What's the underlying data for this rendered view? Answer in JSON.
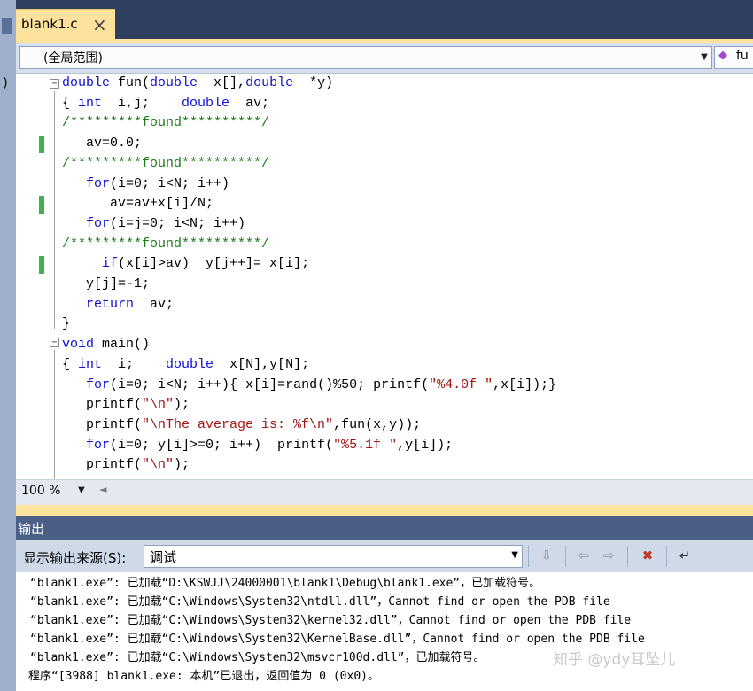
{
  "tab": {
    "filename": "blank1.c",
    "close_glyph": "×"
  },
  "scope_bar": {
    "scope": "(全局范围)",
    "member": "fu"
  },
  "editor": {
    "lines": [
      [
        {
          "t": "double",
          "c": "kw"
        },
        {
          "t": " fun("
        },
        {
          "t": "double",
          "c": "kw"
        },
        {
          "t": "  x[],"
        },
        {
          "t": "double",
          "c": "kw"
        },
        {
          "t": "  *y)"
        }
      ],
      [
        {
          "t": "{ "
        },
        {
          "t": "int",
          "c": "kw"
        },
        {
          "t": "  i,j;    "
        },
        {
          "t": "double",
          "c": "kw"
        },
        {
          "t": "  av;"
        }
      ],
      [
        {
          "t": "/*********found**********/",
          "c": "cm"
        }
      ],
      [
        {
          "t": "   av=0.0;"
        }
      ],
      [
        {
          "t": "/*********found**********/",
          "c": "cm"
        }
      ],
      [
        {
          "t": "   "
        },
        {
          "t": "for",
          "c": "kw"
        },
        {
          "t": "(i=0; i<N; i++)"
        }
      ],
      [
        {
          "t": "      av=av+x[i]/N;"
        }
      ],
      [
        {
          "t": "   "
        },
        {
          "t": "for",
          "c": "kw"
        },
        {
          "t": "(i=j=0; i<N; i++)"
        }
      ],
      [
        {
          "t": "/*********found**********/",
          "c": "cm"
        }
      ],
      [
        {
          "t": "     "
        },
        {
          "t": "if",
          "c": "kw"
        },
        {
          "t": "(x[i]>av)  y[j++]= x[i];"
        }
      ],
      [
        {
          "t": "   y[j]=-1;"
        }
      ],
      [
        {
          "t": "   "
        },
        {
          "t": "return",
          "c": "kw"
        },
        {
          "t": "  av;"
        }
      ],
      [
        {
          "t": "}"
        }
      ],
      [
        {
          "t": "void",
          "c": "kw"
        },
        {
          "t": " main()"
        }
      ],
      [
        {
          "t": "{ "
        },
        {
          "t": "int",
          "c": "kw"
        },
        {
          "t": "  i;    "
        },
        {
          "t": "double",
          "c": "kw"
        },
        {
          "t": "  x[N],y[N];"
        }
      ],
      [
        {
          "t": "   "
        },
        {
          "t": "for",
          "c": "kw"
        },
        {
          "t": "(i=0; i<N; i++){ x[i]=rand()%50; printf("
        },
        {
          "t": "\"%4.0f \"",
          "c": "st"
        },
        {
          "t": ",x[i]);}"
        }
      ],
      [
        {
          "t": "   printf("
        },
        {
          "t": "\"\\n\"",
          "c": "st"
        },
        {
          "t": ");"
        }
      ],
      [
        {
          "t": "   printf("
        },
        {
          "t": "\"\\nThe average is: %f\\n\"",
          "c": "st"
        },
        {
          "t": ",fun(x,y));"
        }
      ],
      [
        {
          "t": "   "
        },
        {
          "t": "for",
          "c": "kw"
        },
        {
          "t": "(i=0; y[i]>=0; i++)  printf("
        },
        {
          "t": "\"%5.1f \"",
          "c": "st"
        },
        {
          "t": ",y[i]);"
        }
      ],
      [
        {
          "t": "   printf("
        },
        {
          "t": "\"\\n\"",
          "c": "st"
        },
        {
          "t": ");"
        }
      ]
    ]
  },
  "status": {
    "zoom": "100 %"
  },
  "output": {
    "title": "输出",
    "source_label": "显示输出来源(S):",
    "source_value": "调试",
    "lines": [
      "“blank1.exe”: 已加载“D:\\KSWJJ\\24000001\\blank1\\Debug\\blank1.exe”，已加载符号。",
      "“blank1.exe”: 已加载“C:\\Windows\\System32\\ntdll.dll”，Cannot find or open the PDB file",
      "“blank1.exe”: 已加载“C:\\Windows\\System32\\kernel32.dll”，Cannot find or open the PDB file",
      "“blank1.exe”: 已加载“C:\\Windows\\System32\\KernelBase.dll”，Cannot find or open the PDB file",
      "“blank1.exe”: 已加载“C:\\Windows\\System32\\msvcr100d.dll”，已加载符号。",
      "程序“[3988] blank1.exe: 本机”已退出，返回值为 0 (0x0)。"
    ]
  },
  "watermark": "知乎 @ydy耳坠儿",
  "colors": {
    "keyword": "#1111d0",
    "comment": "#1a7d1a",
    "string": "#a31515",
    "tab_active": "#fde29d",
    "change_bar": "#3fb14f"
  }
}
